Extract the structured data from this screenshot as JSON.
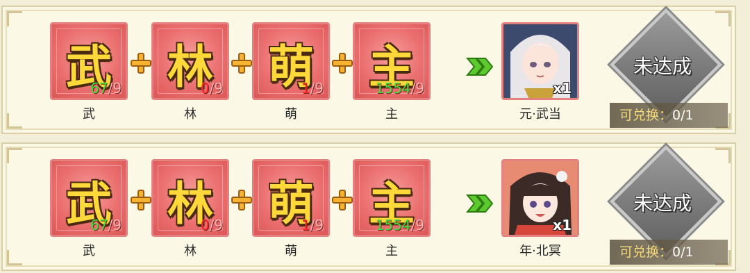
{
  "recipes": [
    {
      "ingredients": [
        {
          "glyph": "武",
          "have": "67",
          "need": "/9",
          "label": "武",
          "enough": true
        },
        {
          "glyph": "林",
          "have": "0",
          "need": "/9",
          "label": "林",
          "enough": false
        },
        {
          "glyph": "萌",
          "have": "1",
          "need": "/9",
          "label": "萌",
          "enough": false
        },
        {
          "glyph": "主",
          "have": "1554",
          "need": "/9",
          "label": "主",
          "enough": true
        }
      ],
      "reward": {
        "name": "元·武当",
        "qty": "x1"
      },
      "status": "未达成",
      "exchange_label": "可兑换：",
      "exchange_value": "0/1"
    },
    {
      "ingredients": [
        {
          "glyph": "武",
          "have": "67",
          "need": "/9",
          "label": "武",
          "enough": true
        },
        {
          "glyph": "林",
          "have": "0",
          "need": "/9",
          "label": "林",
          "enough": false
        },
        {
          "glyph": "萌",
          "have": "1",
          "need": "/9",
          "label": "萌",
          "enough": false
        },
        {
          "glyph": "主",
          "have": "1554",
          "need": "/9",
          "label": "主",
          "enough": true
        }
      ],
      "reward": {
        "name": "年·北冥",
        "qty": "x1"
      },
      "status": "未达成",
      "exchange_label": "可兑换：",
      "exchange_value": "0/1"
    }
  ],
  "icons": {
    "plus": "plus-icon",
    "arrow": "double-arrow-icon"
  },
  "colors": {
    "tile": "#eb6f6f",
    "glyph": "#ffd93a",
    "enough": "#3de03d",
    "lacking": "#ff2a2a",
    "status": "#7a7a7a"
  }
}
